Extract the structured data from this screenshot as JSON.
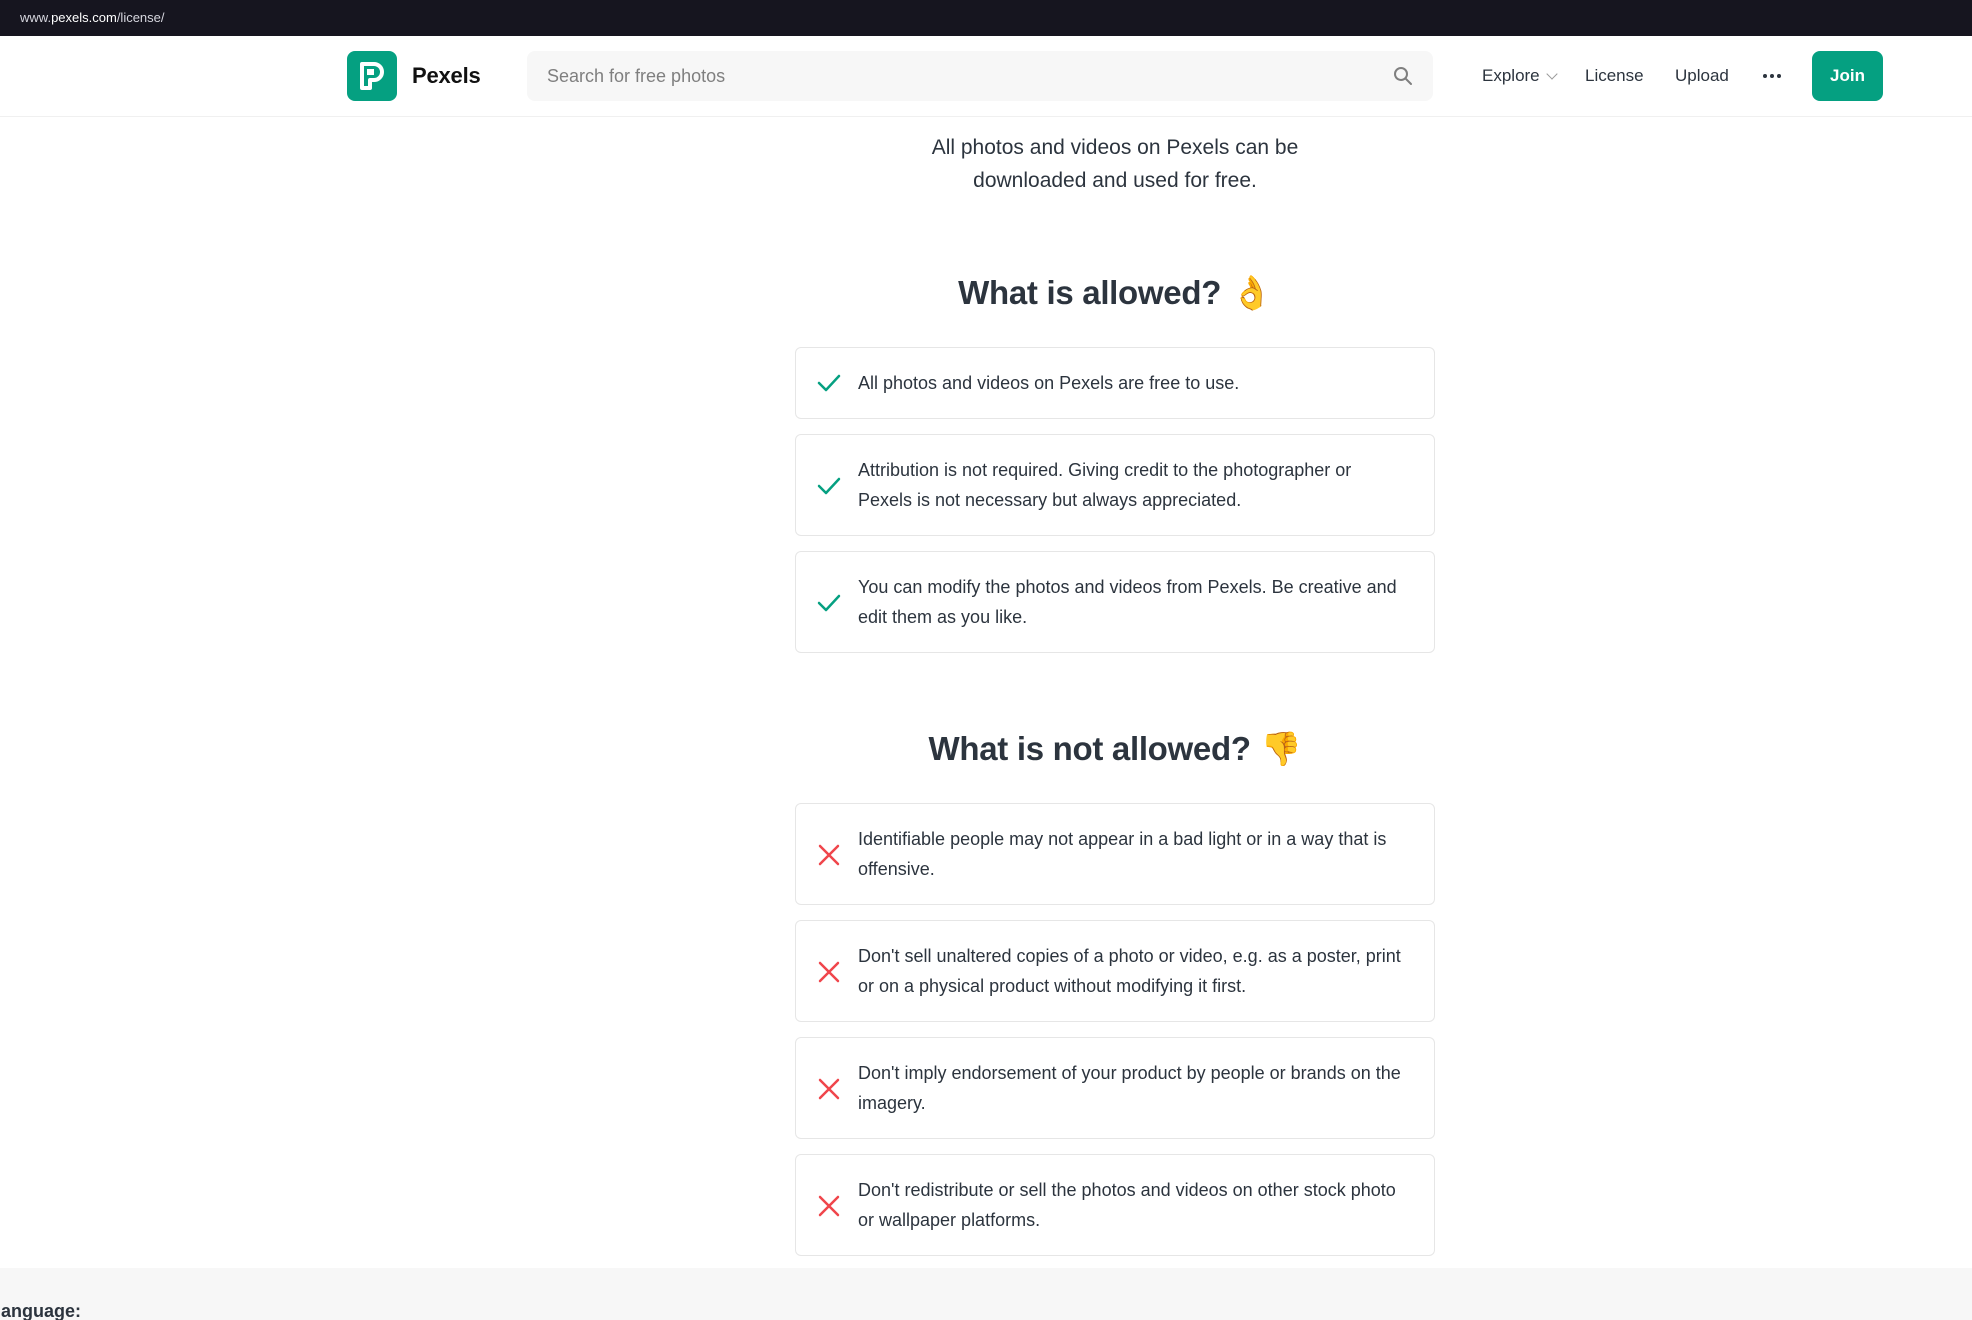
{
  "browser": {
    "url_prefix": "www.",
    "url_domain": "pexels.com",
    "url_path": "/license/"
  },
  "header": {
    "brand": "Pexels",
    "search_placeholder": "Search for free photos",
    "nav": {
      "explore": "Explore",
      "license": "License",
      "upload": "Upload",
      "join": "Join"
    },
    "accent_color": "#05a081"
  },
  "intro_text": "All photos and videos on Pexels can be downloaded and used for free.",
  "allowed": {
    "title": "What is allowed?",
    "emoji": "👌",
    "items": [
      "All photos and videos on Pexels are free to use.",
      "Attribution is not required. Giving credit to the photographer or Pexels is not necessary but always appreciated.",
      "You can modify the photos and videos from Pexels. Be creative and edit them as you like."
    ],
    "icon": "checkmark-icon",
    "icon_color": "#05a081"
  },
  "not_allowed": {
    "title": "What is not allowed?",
    "emoji": "👎",
    "items": [
      "Identifiable people may not appear in a bad light or in a way that is offensive.",
      "Don't sell unaltered copies of a photo or video, e.g. as a poster, print or on a physical product without modifying it first.",
      "Don't imply endorsement of your product by people or brands on the imagery.",
      "Don't redistribute or sell the photos and videos on other stock photo or wallpaper platforms."
    ],
    "icon": "cross-icon",
    "icon_color": "#f0454b"
  },
  "footer": {
    "language_label": "language:"
  }
}
